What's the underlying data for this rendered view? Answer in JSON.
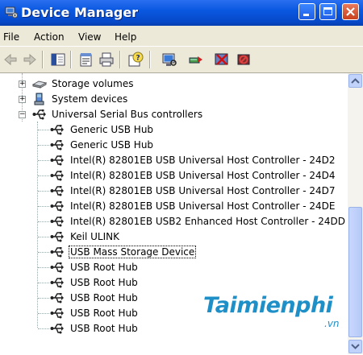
{
  "window": {
    "title": "Device Manager"
  },
  "menu": {
    "items": [
      "File",
      "Action",
      "View",
      "Help"
    ]
  },
  "toolbar": {
    "buttons": [
      "back-icon",
      "forward-icon",
      "show-hide-console-tree-icon",
      "properties-icon",
      "print-icon",
      "help-icon",
      "scan-hardware-icon",
      "update-driver-icon",
      "uninstall-icon",
      "disable-icon"
    ]
  },
  "tree": {
    "categories": [
      {
        "label": "Storage volumes",
        "icon": "storage-volumes-icon",
        "expander": "+"
      },
      {
        "label": "System devices",
        "icon": "system-devices-icon",
        "expander": "+"
      },
      {
        "label": "Universal Serial Bus controllers",
        "icon": "usb-controllers-icon",
        "expander": "−"
      }
    ],
    "usb_devices": [
      "Generic USB Hub",
      "Generic USB Hub",
      "Intel(R) 82801EB USB Universal Host Controller - 24D2",
      "Intel(R) 82801EB USB Universal Host Controller - 24D4",
      "Intel(R) 82801EB USB Universal Host Controller - 24D7",
      "Intel(R) 82801EB USB Universal Host Controller - 24DE",
      "Intel(R) 82801EB USB2 Enhanced Host Controller - 24DD",
      "Keil ULINK",
      "USB Mass Storage Device",
      "USB Root Hub",
      "USB Root Hub",
      "USB Root Hub",
      "USB Root Hub",
      "USB Root Hub"
    ],
    "selected_device": "USB Mass Storage Device"
  },
  "watermark": {
    "brand": "Taimienphi",
    "suffix": ".vn",
    "color": "#1f8fc7"
  }
}
